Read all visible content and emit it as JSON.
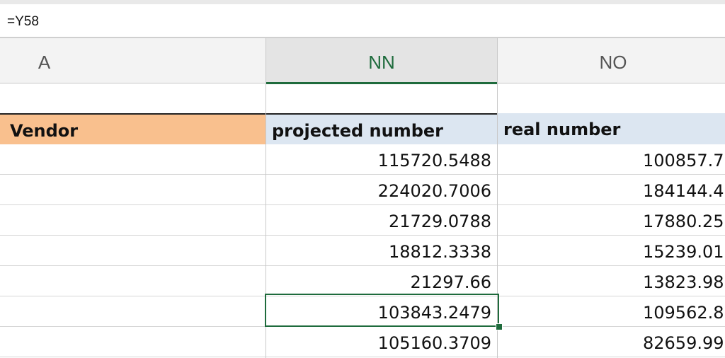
{
  "formula_bar": {
    "content": "=Y58"
  },
  "columns": {
    "a": "A",
    "nn": "NN",
    "no": "NO"
  },
  "headers": {
    "vendor": "Vendor",
    "projected": "projected number",
    "real": "real number"
  },
  "rows": [
    {
      "projected": "115720.5488",
      "real": "100857.7"
    },
    {
      "projected": "224020.7006",
      "real": "184144.4"
    },
    {
      "projected": "21729.0788",
      "real": "17880.25"
    },
    {
      "projected": "18812.3338",
      "real": "15239.01"
    },
    {
      "projected": "21297.66",
      "real": "13823.98"
    },
    {
      "projected": "103843.2479",
      "real": "109562.8"
    },
    {
      "projected": "105160.3709",
      "real": "82659.99"
    }
  ],
  "colors": {
    "accent": "#1e6b3c",
    "vendor_fill": "#f9c08e",
    "header_fill": "#dce6f1"
  }
}
